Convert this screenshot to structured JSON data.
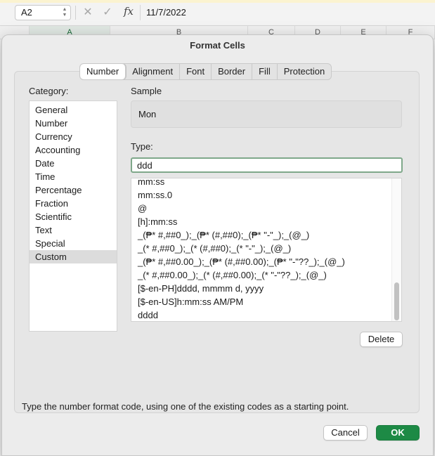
{
  "formula_bar": {
    "name_box": "A2",
    "cancel_glyph": "✕",
    "enter_glyph": "✓",
    "fx_label": "fx",
    "content": "11/7/2022"
  },
  "columns": [
    "A",
    "B",
    "C",
    "D",
    "E",
    "F"
  ],
  "dialog": {
    "title": "Format Cells",
    "tabs": [
      "Number",
      "Alignment",
      "Font",
      "Border",
      "Fill",
      "Protection"
    ],
    "selected_tab": "Number",
    "category_label": "Category:",
    "categories": [
      "General",
      "Number",
      "Currency",
      "Accounting",
      "Date",
      "Time",
      "Percentage",
      "Fraction",
      "Scientific",
      "Text",
      "Special",
      "Custom"
    ],
    "selected_category": "Custom",
    "sample_label": "Sample",
    "sample_value": "Mon",
    "type_label": "Type:",
    "type_value": "ddd",
    "format_codes": [
      "mm:ss",
      "mm:ss.0",
      "@",
      "[h]:mm:ss",
      "_(₱* #,##0_);_(₱* (#,##0);_(₱* \"-\"_);_(@_)",
      "_(* #,##0_);_(* (#,##0);_(* \"-\"_);_(@_)",
      "_(₱* #,##0.00_);_(₱* (#,##0.00);_(₱* \"-\"??_);_(@_)",
      "_(* #,##0.00_);_(* (#,##0.00);_(* \"-\"??_);_(@_)",
      "[$-en-PH]dddd, mmmm d, yyyy",
      "[$-en-US]h:mm:ss AM/PM",
      "dddd"
    ],
    "delete_label": "Delete",
    "hint": "Type the number format code, using one of the existing codes as a starting point.",
    "cancel_label": "Cancel",
    "ok_label": "OK"
  },
  "colors": {
    "accent_green": "#1d8a45",
    "focus_ring": "#7fa88a",
    "selection_gray": "#dcdcdc"
  }
}
